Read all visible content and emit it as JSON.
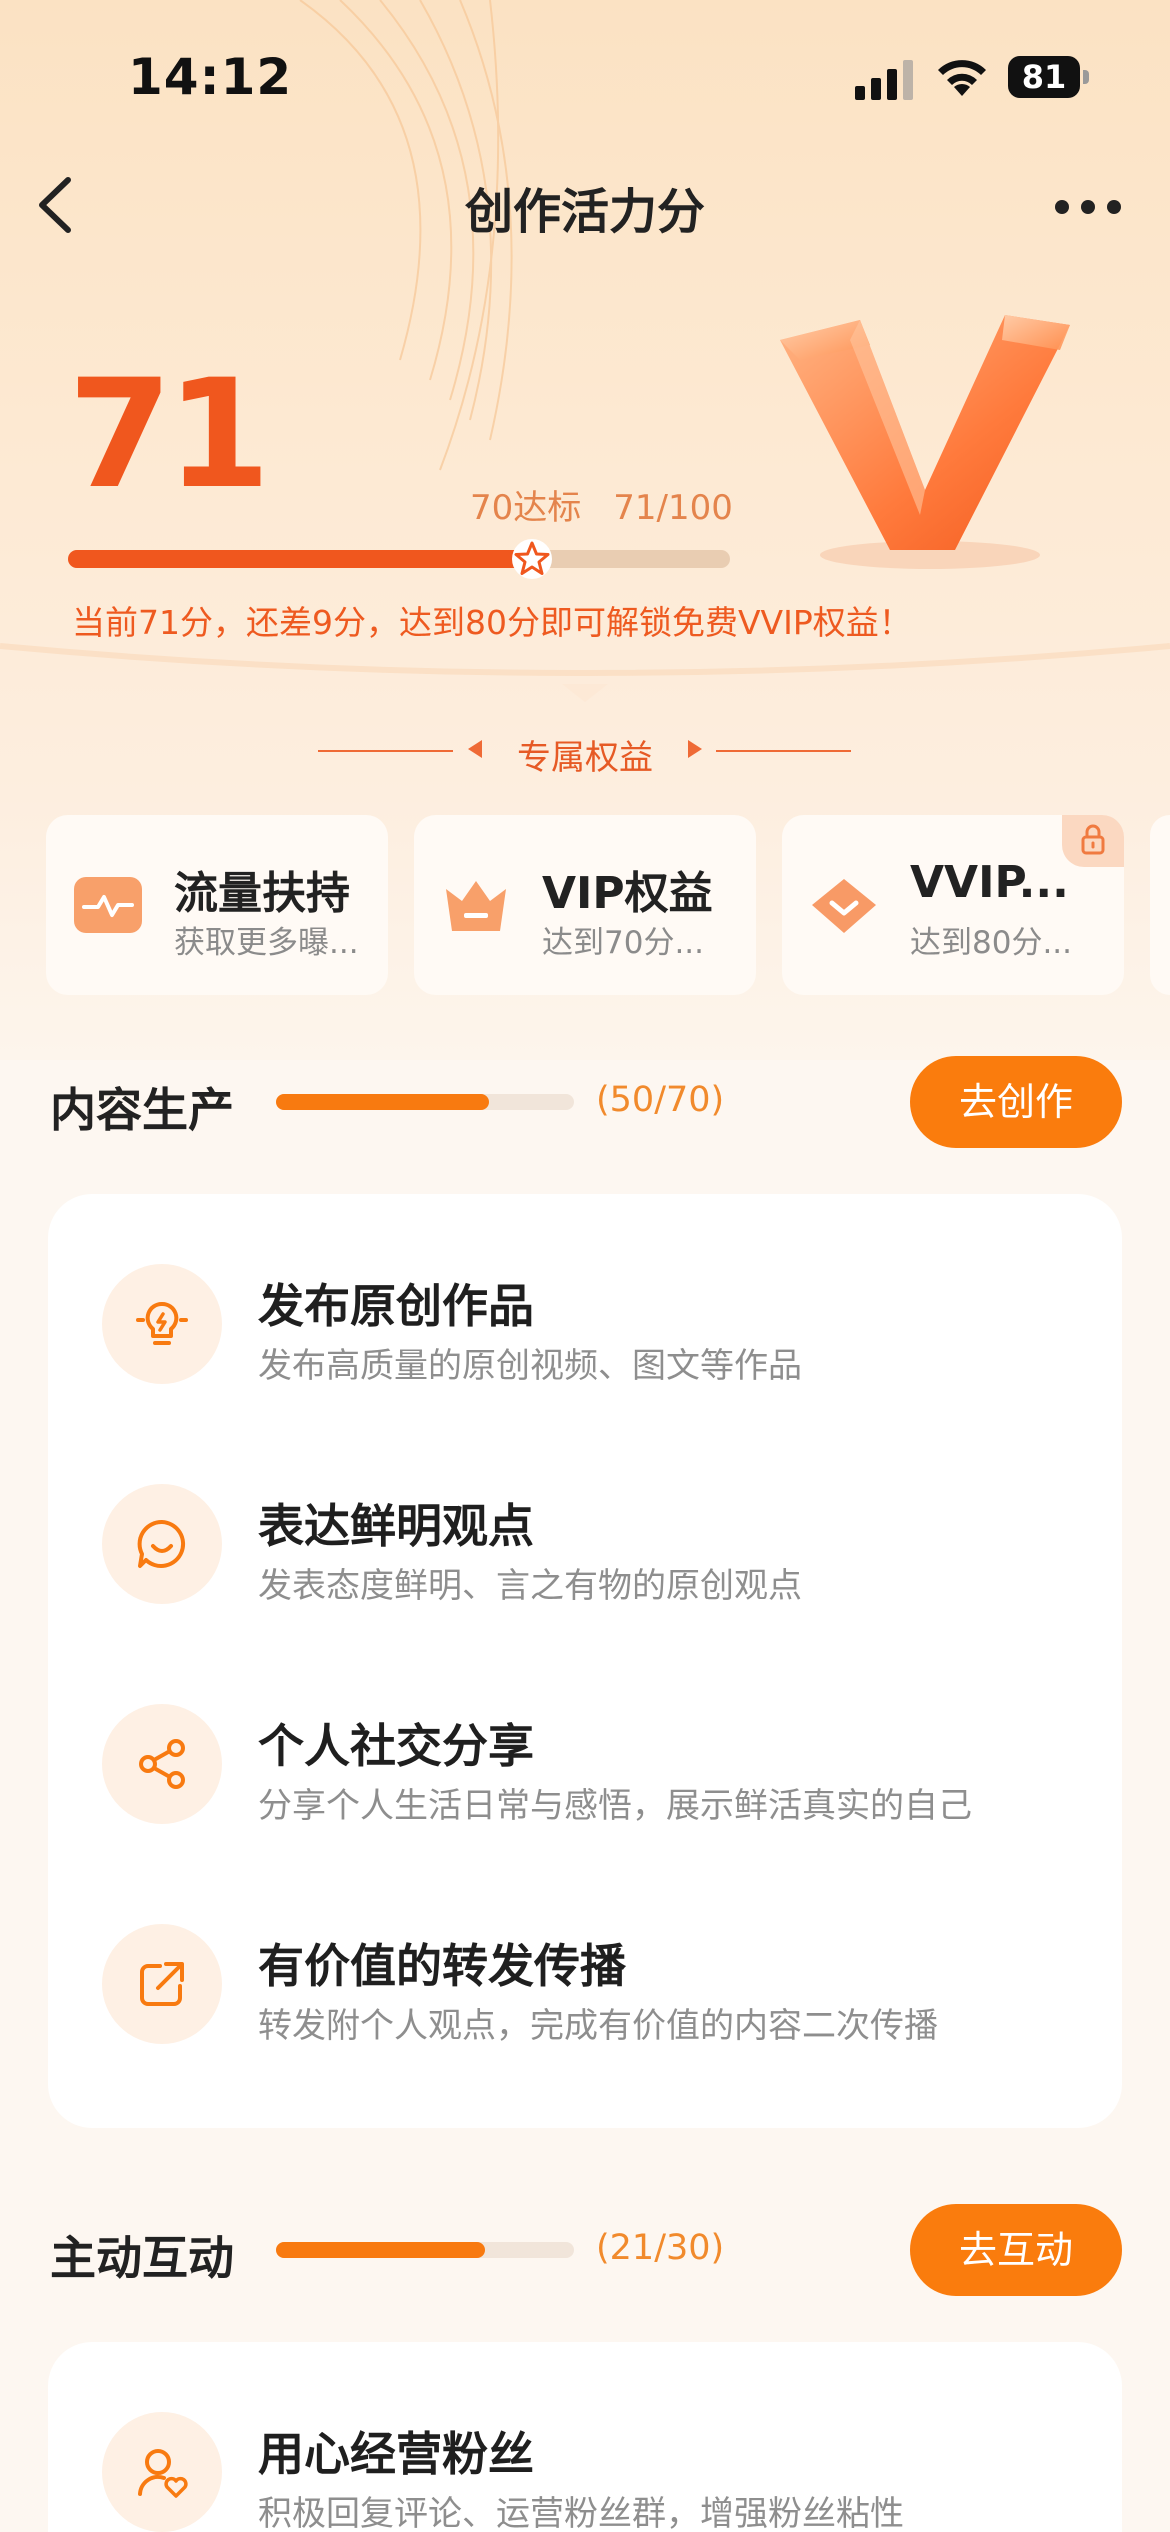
{
  "status_bar": {
    "time": "14:12",
    "battery": "81"
  },
  "nav": {
    "title": "创作活力分"
  },
  "score": {
    "value": "71",
    "target_label": "70达标",
    "progress_label": "71/100",
    "progress_fraction": 0.71,
    "description": "当前71分，还差9分，达到80分即可解锁免费VVIP权益！"
  },
  "benefits": {
    "header": "专属权益",
    "items": [
      {
        "title": "流量扶持",
        "subtitle": "获取更多曝...",
        "icon": "traffic-icon"
      },
      {
        "title": "VIP权益",
        "subtitle": "达到70分...",
        "icon": "crown-icon"
      },
      {
        "title": "VVIP...",
        "subtitle": "达到80分...",
        "icon": "diamond-icon",
        "locked": true
      }
    ]
  },
  "sections": [
    {
      "title": "内容生产",
      "count": "(50/70)",
      "progress_fraction": 0.714,
      "button": "去创作",
      "tasks": [
        {
          "title": "发布原创作品",
          "desc": "发布高质量的原创视频、图文等作品",
          "icon": "lightbulb-icon"
        },
        {
          "title": "表达鲜明观点",
          "desc": "发表态度鲜明、言之有物的原创观点",
          "icon": "chat-bubble-icon"
        },
        {
          "title": "个人社交分享",
          "desc": "分享个人生活日常与感悟，展示鲜活真实的自己",
          "icon": "share-icon"
        },
        {
          "title": "有价值的转发传播",
          "desc": "转发附个人观点，完成有价值的内容二次传播",
          "icon": "forward-icon"
        }
      ]
    },
    {
      "title": "主动互动",
      "count": "(21/30)",
      "progress_fraction": 0.7,
      "button": "去互动",
      "tasks": [
        {
          "title": "用心经营粉丝",
          "desc": "积极回复评论、运营粉丝群，增强粉丝粘性",
          "icon": "fan-heart-icon"
        }
      ]
    }
  ],
  "colors": {
    "accent": "#f0571e",
    "button": "#fa7c0d",
    "count_text": "#f18a2c"
  }
}
